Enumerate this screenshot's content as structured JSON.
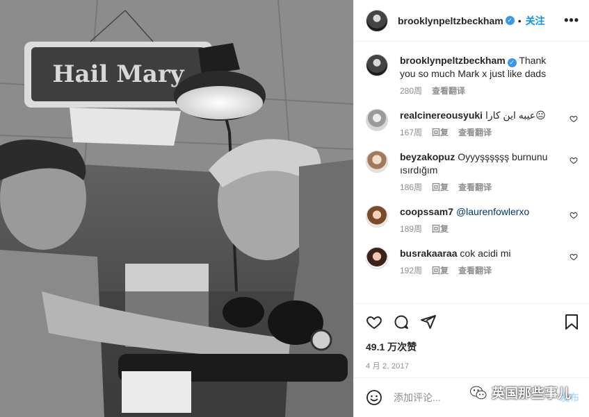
{
  "post": {
    "username": "brooklynpeltzbeckham",
    "separator": "•",
    "follow_label": "关注",
    "more_label": "•••",
    "photo_sign_text": "Hail Mary"
  },
  "caption": {
    "username": "brooklynpeltzbeckham",
    "text": "Thank you so much Mark x just like dads",
    "time": "280周",
    "translate": "查看翻译"
  },
  "comments": [
    {
      "username": "realcinereousyuki",
      "text": "عيبه اين كارا😐",
      "time": "167周",
      "reply": "回复",
      "translate": "查看翻译"
    },
    {
      "username": "beyzakopuz",
      "text": "Oyyyşşşşşş burnunu ısırdığım",
      "time": "186周",
      "reply": "回复",
      "translate": "查看翻译"
    },
    {
      "username": "coopssam7",
      "text": "@laurenfowlerxo",
      "time": "189周",
      "reply": "回复"
    },
    {
      "username": "busrakaaraa",
      "text": "cok acidi mi",
      "time": "192周",
      "reply": "回复",
      "translate": "查看翻译"
    }
  ],
  "stats": {
    "likes": "49.1 万次赞",
    "date": "4 月 2, 2017"
  },
  "add_comment": {
    "placeholder": "添加评论...",
    "post_label": "发布"
  },
  "watermark": {
    "text": "英国那些事儿"
  },
  "colors": {
    "accent": "#0095f6",
    "verified": "#3897f0",
    "muted": "#8e8e8e"
  },
  "icons": [
    "verified-badge-icon",
    "heart-icon",
    "comment-icon",
    "share-icon",
    "bookmark-icon",
    "emoji-icon",
    "wechat-icon"
  ]
}
